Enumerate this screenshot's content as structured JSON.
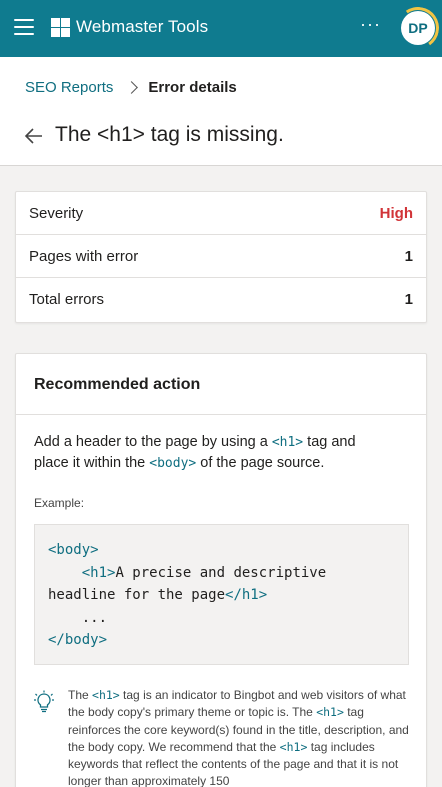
{
  "app": {
    "title": "Webmaster Tools",
    "more_label": "···",
    "avatar_initials": "DP"
  },
  "breadcrumb": {
    "parent": "SEO Reports",
    "current": "Error details"
  },
  "page": {
    "title": "The <h1> tag is missing."
  },
  "summary": {
    "rows": [
      {
        "label": "Severity",
        "value": "High"
      },
      {
        "label": "Pages with error",
        "value": "1"
      },
      {
        "label": "Total errors",
        "value": "1"
      }
    ]
  },
  "recommended": {
    "title": "Recommended action",
    "body_part1": "Add a header to the page by using a ",
    "body_code1": "<h1>",
    "body_part2": " tag and place it within the ",
    "body_code2": "<body>",
    "body_part3": " of the page source.",
    "example_label": "Example:",
    "code_line1": "<body>",
    "code_line2_tag_open": "<h1>",
    "code_line2_text": "A precise and descriptive",
    "code_line3_text": "headline for the page",
    "code_line3_tag_close": "</h1>",
    "code_line4": "...",
    "code_line5": "</body>",
    "tip_part1": "The ",
    "tip_code1": "<h1>",
    "tip_part2": " tag is an indicator to Bingbot and web visitors of what the body copy's primary theme or topic is. The ",
    "tip_code2": "<h1>",
    "tip_part3": " tag reinforces the core keyword(s) found in the title, description, and the body copy. We recommend that the ",
    "tip_code3": "<h1>",
    "tip_part4": " tag includes keywords that reflect the contents of the page and that it is not longer than approximately 150"
  },
  "colors": {
    "brand": "#0f7b8f",
    "link": "#0f6e80",
    "severity_high": "#d13438"
  }
}
